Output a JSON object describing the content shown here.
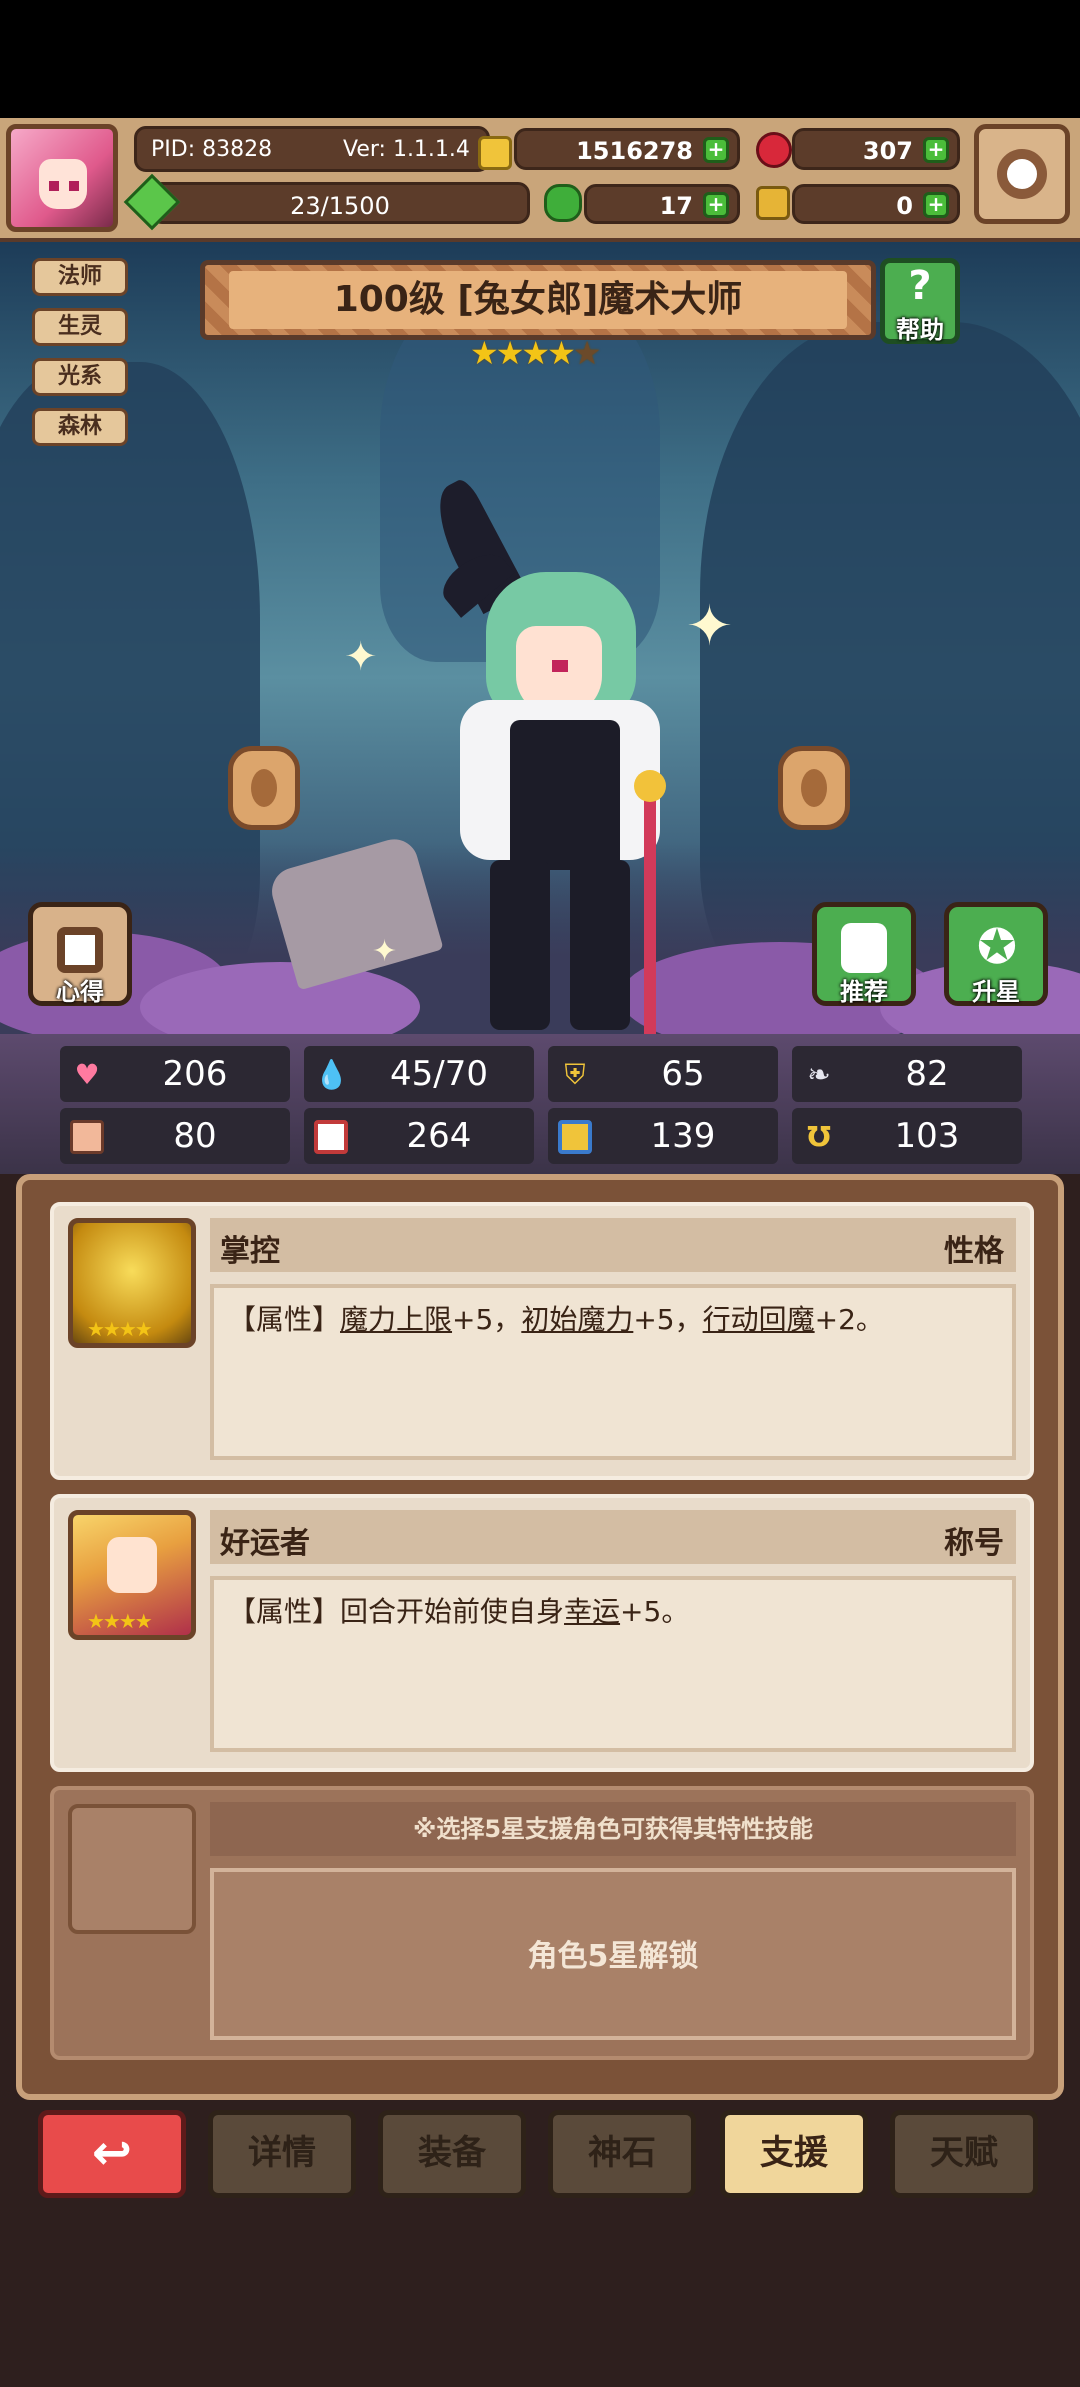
{
  "header": {
    "pid": "PID: 83828",
    "version": "Ver: 1.1.1.4",
    "gold": "1516278",
    "gems": "307",
    "exp_progress": "23/1500",
    "clover": "17",
    "key": "0"
  },
  "tags": [
    "法师",
    "生灵",
    "光系",
    "森林"
  ],
  "character": {
    "title": "100级  [兔女郎]魔术大师",
    "stars": 4,
    "max_stars": 5
  },
  "buttons": {
    "help": "帮助",
    "insight": "心得",
    "recommend": "推荐",
    "star_up": "升星"
  },
  "stats": [
    {
      "icon": "heart-icon",
      "value": "206"
    },
    {
      "icon": "mana-drop-icon",
      "value": "45/70"
    },
    {
      "icon": "shield-icon",
      "value": "65"
    },
    {
      "icon": "wing-icon",
      "value": "82"
    },
    {
      "icon": "fist-icon",
      "value": "80"
    },
    {
      "icon": "book-icon",
      "value": "264"
    },
    {
      "icon": "boot-icon",
      "value": "139"
    },
    {
      "icon": "horseshoe-icon",
      "value": "103"
    }
  ],
  "support": {
    "cards": [
      {
        "name": "掌控",
        "type": "性格",
        "desc_prefix": "【属性】",
        "desc_parts": [
          {
            "text": "魔力上限",
            "u": true
          },
          {
            "text": "+5，",
            "u": false
          },
          {
            "text": "初始魔力",
            "u": true
          },
          {
            "text": "+5，",
            "u": false
          },
          {
            "text": "行动回魔",
            "u": true
          },
          {
            "text": "+2。",
            "u": false
          }
        ],
        "stars": 4
      },
      {
        "name": "好运者",
        "type": "称号",
        "desc_prefix": "【属性】",
        "desc_parts": [
          {
            "text": "回合开始前使自身",
            "u": false
          },
          {
            "text": "幸运",
            "u": true
          },
          {
            "text": "+5。",
            "u": false
          }
        ],
        "stars": 4
      }
    ],
    "locked_hint": "※选择5星支援角色可获得其特性技能",
    "locked_label": "角色5星解锁"
  },
  "nav": {
    "back": "↩",
    "tabs": [
      "详情",
      "装备",
      "神石",
      "支援",
      "天赋"
    ],
    "active": "支援"
  },
  "colors": {
    "accent_green": "#4bbd3a",
    "star_gold": "#f3c416",
    "back_red": "#e84b4b",
    "active_tab": "#f0d69b"
  }
}
